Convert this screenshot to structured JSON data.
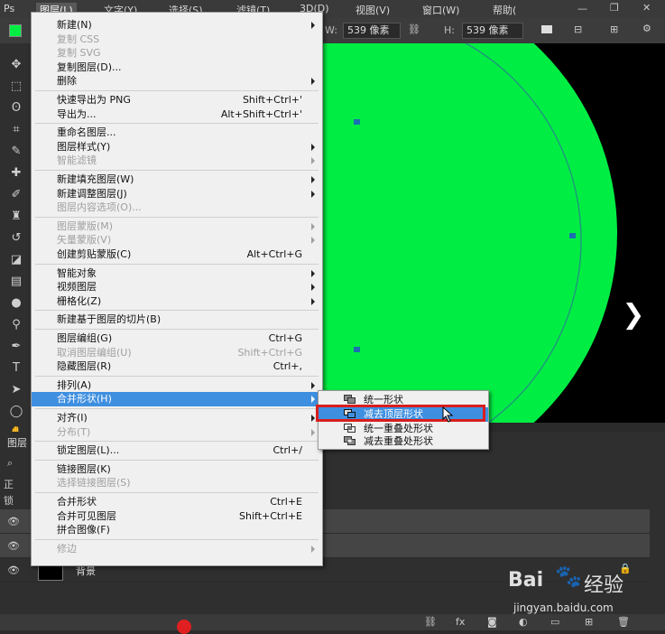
{
  "menubar": {
    "items": [
      {
        "label": "图层(L)",
        "active": true
      },
      {
        "label": "文字(Y)"
      },
      {
        "label": "选择(S)"
      },
      {
        "label": "滤镜(T)"
      },
      {
        "label": "3D(D)"
      },
      {
        "label": "视图(V)"
      },
      {
        "label": "窗口(W)"
      },
      {
        "label": "帮助("
      }
    ]
  },
  "options_bar": {
    "w_label": "W:",
    "w_value": "539 像素",
    "h_label": "H:",
    "h_value": "539 像素"
  },
  "canvas": {
    "shape_color": "#00ee44",
    "background_color": "#000000"
  },
  "layer_menu": {
    "items": [
      {
        "label": "新建(N)",
        "submenu": true
      },
      {
        "label": "复制 CSS",
        "disabled": true
      },
      {
        "label": "复制 SVG",
        "disabled": true
      },
      {
        "label": "复制图层(D)..."
      },
      {
        "label": "删除",
        "submenu": true
      },
      {
        "separator": true
      },
      {
        "label": "快速导出为 PNG",
        "shortcut": "Shift+Ctrl+'"
      },
      {
        "label": "导出为...",
        "shortcut": "Alt+Shift+Ctrl+'"
      },
      {
        "separator": true
      },
      {
        "label": "重命名图层..."
      },
      {
        "label": "图层样式(Y)",
        "submenu": true
      },
      {
        "label": "智能滤镜",
        "disabled": true,
        "submenu": true
      },
      {
        "separator": true
      },
      {
        "label": "新建填充图层(W)",
        "submenu": true
      },
      {
        "label": "新建调整图层(J)",
        "submenu": true
      },
      {
        "label": "图层内容选项(O)...",
        "disabled": true
      },
      {
        "separator": true
      },
      {
        "label": "图层蒙版(M)",
        "disabled": true,
        "submenu": true
      },
      {
        "label": "矢量蒙版(V)",
        "disabled": true,
        "submenu": true
      },
      {
        "label": "创建剪贴蒙版(C)",
        "shortcut": "Alt+Ctrl+G"
      },
      {
        "separator": true
      },
      {
        "label": "智能对象",
        "submenu": true
      },
      {
        "label": "视频图层",
        "submenu": true
      },
      {
        "label": "栅格化(Z)",
        "submenu": true
      },
      {
        "separator": true
      },
      {
        "label": "新建基于图层的切片(B)"
      },
      {
        "separator": true
      },
      {
        "label": "图层编组(G)",
        "shortcut": "Ctrl+G"
      },
      {
        "label": "取消图层编组(U)",
        "shortcut": "Shift+Ctrl+G",
        "disabled": true
      },
      {
        "label": "隐藏图层(R)",
        "shortcut": "Ctrl+,"
      },
      {
        "separator": true
      },
      {
        "label": "排列(A)",
        "submenu": true
      },
      {
        "label": "合并形状(H)",
        "submenu": true,
        "highlighted": true
      },
      {
        "separator": true
      },
      {
        "label": "对齐(I)",
        "submenu": true
      },
      {
        "label": "分布(T)",
        "disabled": true,
        "submenu": true
      },
      {
        "separator": true
      },
      {
        "label": "锁定图层(L)...",
        "shortcut": "Ctrl+/"
      },
      {
        "separator": true
      },
      {
        "label": "链接图层(K)"
      },
      {
        "label": "选择链接图层(S)",
        "disabled": true
      },
      {
        "separator": true
      },
      {
        "label": "合并形状",
        "shortcut": "Ctrl+E"
      },
      {
        "label": "合并可见图层",
        "shortcut": "Shift+Ctrl+E"
      },
      {
        "label": "拼合图像(F)"
      },
      {
        "separator": true
      },
      {
        "label": "修边",
        "disabled": true,
        "submenu": true
      }
    ]
  },
  "merge_submenu": {
    "items": [
      {
        "label": "统一形状",
        "icon": "unite-shapes-icon"
      },
      {
        "label": "减去顶层形状",
        "icon": "subtract-front-icon",
        "highlighted": true
      },
      {
        "label": "统一重叠处形状",
        "icon": "intersect-shapes-icon"
      },
      {
        "label": "减去重叠处形状",
        "icon": "exclude-overlap-icon"
      }
    ]
  },
  "layers_panel": {
    "tab_label": "图层",
    "kind_label": "正",
    "lock_label": "锁",
    "background_layer_name": "背景"
  },
  "watermark": {
    "brand": "Bai",
    "brand_suffix": "经验",
    "url": "jingyan.baidu.com"
  }
}
